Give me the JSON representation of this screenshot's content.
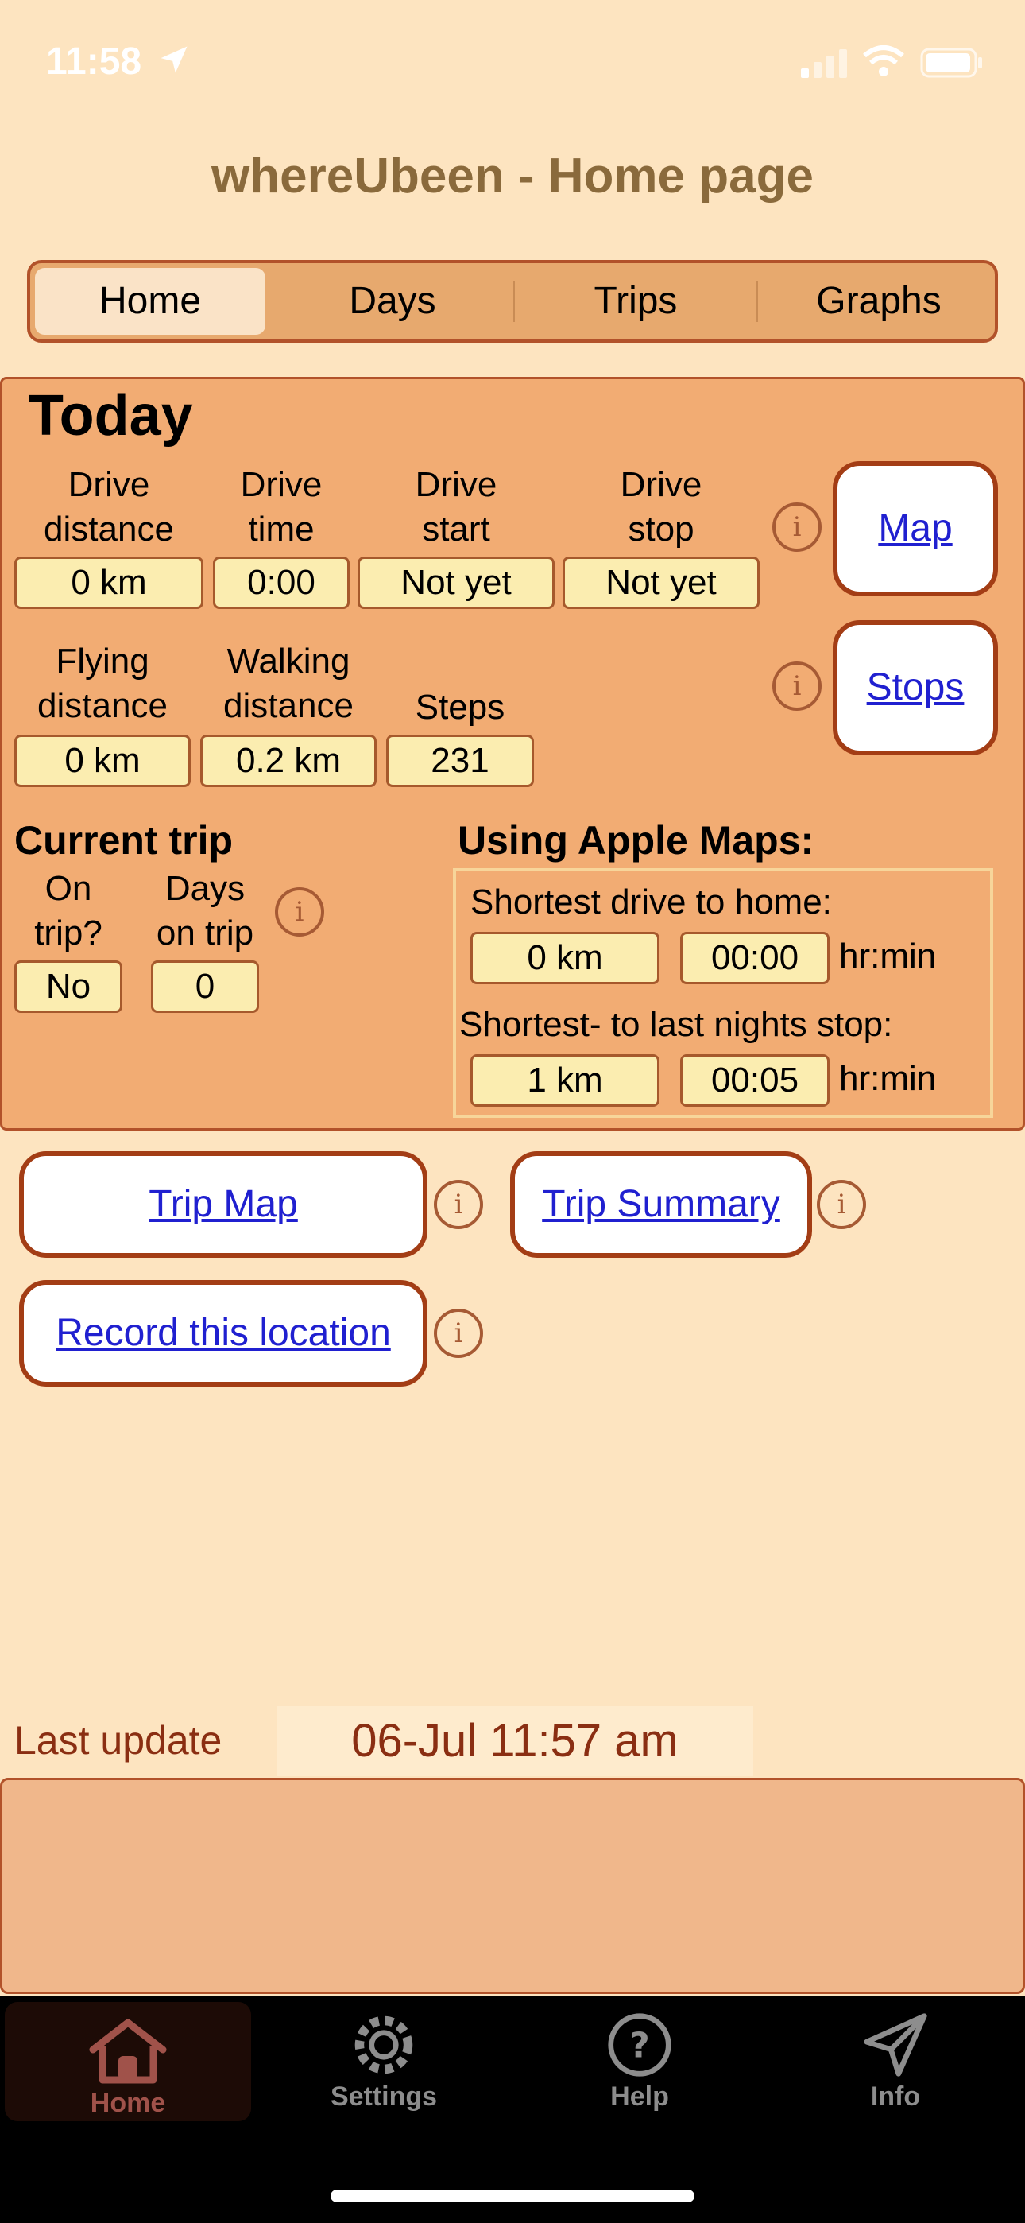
{
  "status_bar": {
    "time": "11:58"
  },
  "page_title": "whereUbeen - Home page",
  "segments": [
    "Home",
    "Days",
    "Trips",
    "Graphs"
  ],
  "today": {
    "heading": "Today",
    "drive_distance": {
      "label1": "Drive",
      "label2": "distance",
      "value": "0 km"
    },
    "drive_time": {
      "label1": "Drive",
      "label2": "time",
      "value": "0:00"
    },
    "drive_start": {
      "label1": "Drive",
      "label2": "start",
      "value": "Not yet"
    },
    "drive_stop": {
      "label1": "Drive",
      "label2": "stop",
      "value": "Not yet"
    },
    "flying_distance": {
      "label1": "Flying",
      "label2": "distance",
      "value": "0 km"
    },
    "walking_distance": {
      "label1": "Walking",
      "label2": "distance",
      "value": "0.2 km"
    },
    "steps": {
      "label": "Steps",
      "value": "231"
    },
    "map_button": "Map",
    "stops_button": "Stops"
  },
  "current_trip": {
    "heading": "Current trip",
    "on_trip": {
      "label1": "On",
      "label2": "trip?",
      "value": "No"
    },
    "days_on_trip": {
      "label1": "Days",
      "label2": "on trip",
      "value": "0"
    }
  },
  "apple_maps": {
    "heading": "Using Apple Maps:",
    "home_label": "Shortest drive to home:",
    "home_distance": "0 km",
    "home_time": "00:00",
    "unit": "hr:min",
    "last_stop_label": "Shortest- to last nights stop:",
    "last_stop_distance": "1 km",
    "last_stop_time": "00:05"
  },
  "buttons": {
    "trip_map": "Trip Map",
    "trip_summary": "Trip Summary",
    "record_location": "Record this location"
  },
  "info_glyph": "i",
  "last_update": {
    "label": "Last update",
    "value": "06-Jul 11:57 am"
  },
  "tabbar": [
    "Home",
    "Settings",
    "Help",
    "Info"
  ]
}
